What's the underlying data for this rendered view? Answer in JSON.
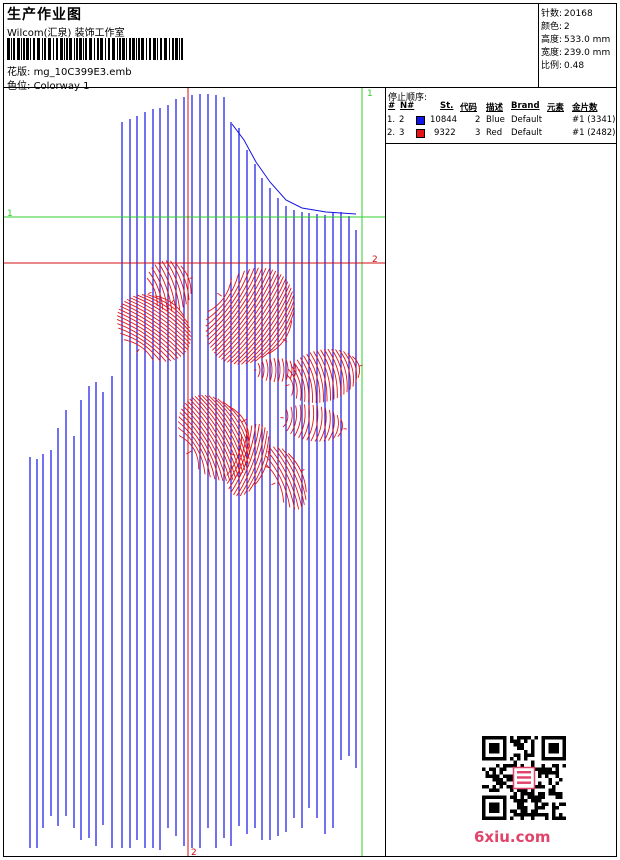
{
  "header": {
    "title": "生产作业图",
    "studio": "Wilcom(汇泉) 装饰工作室",
    "design_label": "花版:",
    "design_value": "mg_10C399E3.emb",
    "colorway_label": "色位:",
    "colorway_value": "Colorway 1"
  },
  "stats": [
    {
      "label": "针数:",
      "value": "20168"
    },
    {
      "label": "颜色:",
      "value": "2"
    },
    {
      "label": "高度:",
      "value": "533.0 mm"
    },
    {
      "label": "宽度:",
      "value": "239.0 mm"
    },
    {
      "label": "比例:",
      "value": "0.48"
    }
  ],
  "stop_sequence": {
    "title": "停止顺序:",
    "columns": [
      "#",
      "N#",
      "St.",
      "代码",
      "描述",
      "Brand",
      "元素",
      "金片数"
    ],
    "rows": [
      {
        "num": "1.",
        "n": "2",
        "color": "#1414e6",
        "st": "10844",
        "code": "2",
        "desc": "Blue",
        "brand": "Default",
        "element": "#1 (3341)"
      },
      {
        "num": "2.",
        "n": "3",
        "color": "#e61414",
        "st": "9322",
        "code": "3",
        "desc": "Red",
        "brand": "Default",
        "element": "#1 (2482)"
      }
    ]
  },
  "guides": {
    "green_v_label": "1",
    "green_h_label": "1",
    "red_h_label": "2",
    "red_v_label": "2"
  },
  "colors": {
    "blue_thread": "#1414e6",
    "red_thread": "#e61414",
    "green_guide": "#2fcf2f",
    "red_guide": "#d01010",
    "watermark": "#e0446a"
  },
  "watermark": {
    "text": "6xiu.com",
    "stamp_icon": "red-seal-icon"
  }
}
